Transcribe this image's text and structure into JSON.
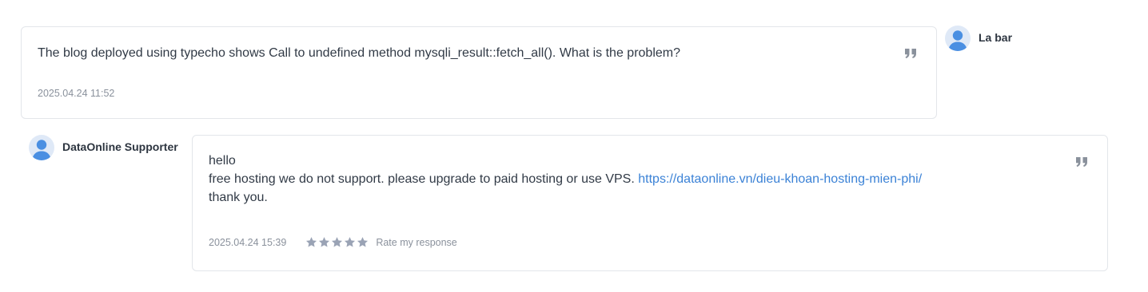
{
  "thread": {
    "customer_message": {
      "author": "La bar",
      "lines": [
        "The blog deployed using typecho shows Call to undefined method mysqli_result::fetch_all(). What is the problem?"
      ],
      "timestamp": "2025.04.24 11:52"
    },
    "staff_message": {
      "author": "DataOnline Supporter",
      "line1": "hello",
      "line2_text": "free hosting we do not support. please upgrade to paid hosting or use VPS. ",
      "line2_link": "https://dataonline.vn/dieu-khoan-hosting-mien-phi/",
      "line3": "thank you.",
      "timestamp": "2025.04.24 15:39",
      "rating_label": "Rate my response",
      "rating_stars": 5
    }
  },
  "colors": {
    "link": "#3b82d6",
    "muted": "#8a919c",
    "border": "#e3e6ea",
    "avatar_bg": "#dfe9f7",
    "avatar_fg": "#4a8fe2",
    "star": "#9aa3b5"
  },
  "icons": {
    "quote": "quote-icon",
    "avatar": "user-avatar-icon",
    "star": "star-icon"
  }
}
